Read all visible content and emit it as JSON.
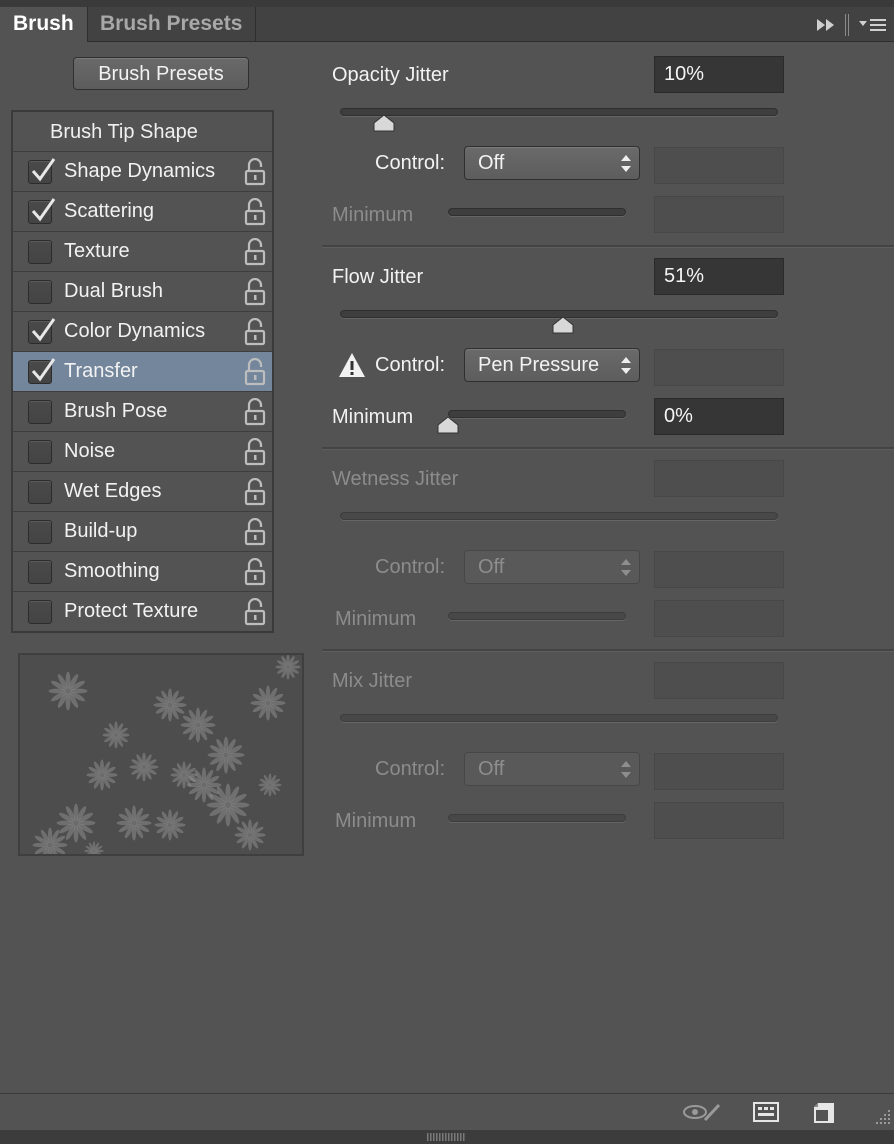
{
  "tabs": {
    "brush": "Brush",
    "brush_presets": "Brush Presets"
  },
  "presets_button": "Brush Presets",
  "list": {
    "header": "Brush Tip Shape",
    "items": [
      {
        "label": "Shape Dynamics",
        "checked": true
      },
      {
        "label": "Scattering",
        "checked": true
      },
      {
        "label": "Texture",
        "checked": false
      },
      {
        "label": "Dual Brush",
        "checked": false
      },
      {
        "label": "Color Dynamics",
        "checked": true
      },
      {
        "label": "Transfer",
        "checked": true,
        "selected": true
      },
      {
        "label": "Brush Pose",
        "checked": false
      },
      {
        "label": "Noise",
        "checked": false
      },
      {
        "label": "Wet Edges",
        "checked": false
      },
      {
        "label": "Build-up",
        "checked": false
      },
      {
        "label": "Smoothing",
        "checked": false
      },
      {
        "label": "Protect Texture",
        "checked": false
      }
    ]
  },
  "opacity": {
    "label": "Opacity Jitter",
    "value": "10%",
    "slider_fraction": 0.1,
    "control_label": "Control:",
    "control_value": "Off",
    "minimum_label": "Minimum"
  },
  "flow": {
    "label": "Flow Jitter",
    "value": "51%",
    "slider_fraction": 0.51,
    "control_label": "Control:",
    "control_value": "Pen Pressure",
    "minimum_label": "Minimum",
    "minimum_value": "0%",
    "minimum_fraction": 0.0
  },
  "wetness": {
    "label": "Wetness Jitter",
    "control_label": "Control:",
    "control_value": "Off",
    "minimum_label": "Minimum"
  },
  "mix": {
    "label": "Mix Jitter",
    "control_label": "Control:",
    "control_value": "Off",
    "minimum_label": "Minimum"
  },
  "colors": {
    "panel": "#535353",
    "selected_row": "#73869c",
    "field_dark": "#363636"
  },
  "icons": [
    "fast-forward-icon",
    "panel-menu-icon",
    "lock-icon",
    "warning-icon",
    "eye-brush-icon",
    "brush-panel-icon",
    "new-preset-icon",
    "resize-grip-icon"
  ]
}
